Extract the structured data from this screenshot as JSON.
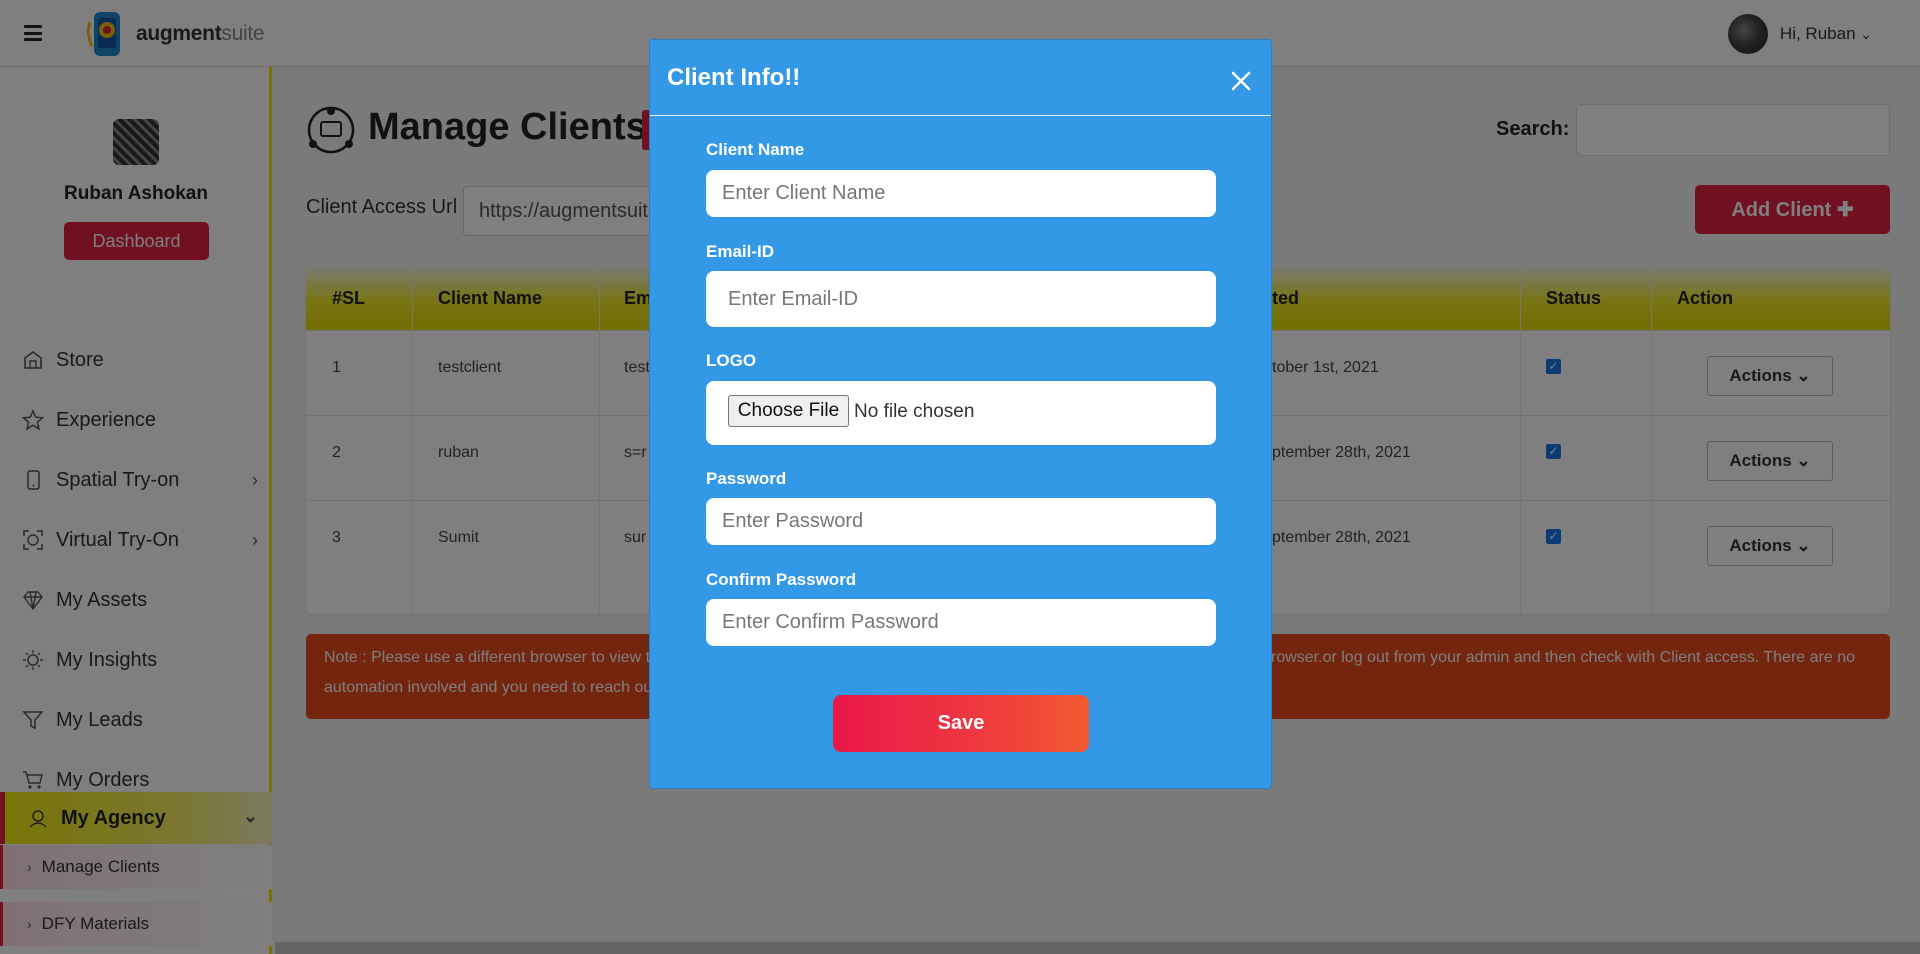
{
  "header": {
    "brand_bold": "augment",
    "brand_light": "suite",
    "greeting": "Hi, Ruban",
    "greeting_chevron": "⌄"
  },
  "sidebar": {
    "profile_name": "Ruban Ashokan",
    "dashboard_label": "Dashboard",
    "items": [
      {
        "label": "Store",
        "icon": "store-icon"
      },
      {
        "label": "Experience",
        "icon": "star-icon"
      },
      {
        "label": "Spatial Try-on",
        "icon": "phone-icon",
        "chevron": "›"
      },
      {
        "label": "Virtual Try-On",
        "icon": "face-scan-icon",
        "chevron": "›"
      },
      {
        "label": "My Assets",
        "icon": "diamond-icon"
      },
      {
        "label": "My Insights",
        "icon": "insights-icon"
      },
      {
        "label": "My Leads",
        "icon": "funnel-icon"
      },
      {
        "label": "My Orders",
        "icon": "cart-icon"
      }
    ],
    "active_item": {
      "label": "My Agency",
      "icon": "agency-icon",
      "chevron": "⌄"
    },
    "sub_items": [
      {
        "label": "Manage Clients",
        "marker": "›"
      },
      {
        "label": "DFY Materials",
        "marker": "›"
      }
    ]
  },
  "main": {
    "page_title": "Manage Clients",
    "search_label": "Search:",
    "access_label": "Client Access Url",
    "access_value": "https://augmentsuite",
    "add_button": "Add Client ✚"
  },
  "table": {
    "headers": [
      "#SL",
      "Client Name",
      "Em",
      "ted",
      "Status",
      "Action"
    ],
    "rows": [
      {
        "sl": "1",
        "name": "testclient",
        "email": "test",
        "date": "tober 1st, 2021",
        "status": true,
        "action": "Actions ⌄"
      },
      {
        "sl": "2",
        "name": "ruban",
        "email": "s=r",
        "date": "ptember 28th, 2021",
        "status": true,
        "action": "Actions ⌄"
      },
      {
        "sl": "3",
        "name": "Sumit",
        "email": "sur",
        "date": "ptember 28th, 2021",
        "status": true,
        "action": "Actions ⌄"
      }
    ]
  },
  "note": {
    "left_line1": "Note : Please use a different browser to view t",
    "left_line2": "automation involved and you need to reach ou",
    "right_line1": "rowser.or log out from your admin and then check with Client access. There are no"
  },
  "modal": {
    "title": "Client Info!!",
    "fields": {
      "client_name": {
        "label": "Client Name",
        "placeholder": "Enter Client Name"
      },
      "email": {
        "label": "Email-ID",
        "placeholder": "Enter Email-ID"
      },
      "logo": {
        "label": "LOGO",
        "button": "Choose File",
        "status": "No file chosen"
      },
      "password": {
        "label": "Password",
        "placeholder": "Enter Password"
      },
      "confirm_password": {
        "label": "Confirm Password",
        "placeholder": "Enter Confirm Password"
      }
    },
    "save_label": "Save"
  },
  "colors": {
    "accent_red": "#e02040",
    "sidebar_yellow": "#f0e400",
    "modal_blue": "#3399e6",
    "note_orange": "#e84a1c"
  }
}
